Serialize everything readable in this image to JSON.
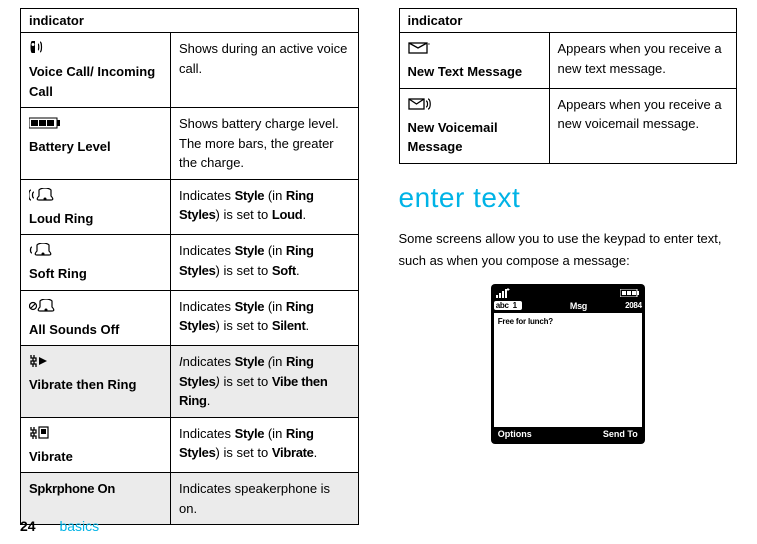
{
  "leftTable": {
    "header": "indicator",
    "rows": [
      {
        "iconName": "voice-call-icon",
        "label": "Voice Call/ Incoming Call",
        "desc": "Shows during an active voice call."
      },
      {
        "iconName": "battery-level-icon",
        "label": "Battery Level",
        "desc": "Shows battery charge level. The more bars, the greater the charge."
      },
      {
        "iconName": "loud-ring-icon",
        "label": "Loud Ring",
        "descPrefix": "Indicates ",
        "styleWord": "Style",
        "descMid": " (in ",
        "ringStyles": "Ring Styles",
        "descMid2": ") is set to ",
        "value": "Loud",
        "descSuffix": "."
      },
      {
        "iconName": "soft-ring-icon",
        "label": "Soft Ring",
        "descPrefix": "Indicates ",
        "styleWord": "Style",
        "descMid": " (in ",
        "ringStyles": "Ring Styles",
        "descMid2": ") is set to ",
        "value": "Soft",
        "descSuffix": "."
      },
      {
        "iconName": "all-sounds-off-icon",
        "label": "All Sounds Off",
        "descPrefix": "Indicates ",
        "styleWord": "Style",
        "descMid": " (in ",
        "ringStyles": "Ring Styles",
        "descMid2": ") is set to ",
        "value": "Silent",
        "descSuffix": "."
      },
      {
        "iconName": "vibrate-then-ring-icon",
        "label": "Vibrate then Ring",
        "descPrefixItalicI": "I",
        "descPrefixRest": "ndicates ",
        "styleWord": "Style",
        "descMidItalicOpen": " (",
        "descMidRest": "in ",
        "ringStyles": "Ring Styles",
        "descMid2ItalicClose": ")",
        "descMid2Rest": " is set to ",
        "value": "Vibe then Ring",
        "descSuffix": "."
      },
      {
        "iconName": "vibrate-icon",
        "label": "Vibrate",
        "descPrefix": "Indicates ",
        "styleWord": "Style",
        "descMid": " (in ",
        "ringStyles": "Ring Styles",
        "descMid2": ") is set to ",
        "value": "Vibrate",
        "descSuffix": "."
      },
      {
        "iconName": "speakerphone-on-icon",
        "labelCondensed": "Spkrphone On",
        "desc": "Indicates speakerphone is on."
      }
    ]
  },
  "rightTable": {
    "header": "indicator",
    "rows": [
      {
        "iconName": "new-text-message-icon",
        "label": "New Text Message",
        "desc": "Appears when you receive a new text message."
      },
      {
        "iconName": "new-voicemail-message-icon",
        "label": "New Voicemail Message",
        "desc": "Appears when you receive a new voicemail message."
      }
    ]
  },
  "section": {
    "heading": "enter text",
    "body": "Some screens allow you to use the keypad to enter text, such as when you compose a message:"
  },
  "phone": {
    "abc": "abc",
    "abcNum": "1",
    "titleMsg": "Msg",
    "count": "2084",
    "bodyText": "Free for lunch?",
    "leftSoft": "Options",
    "rightSoft": "Send To"
  },
  "footer": {
    "page": "24",
    "section": "basics"
  }
}
